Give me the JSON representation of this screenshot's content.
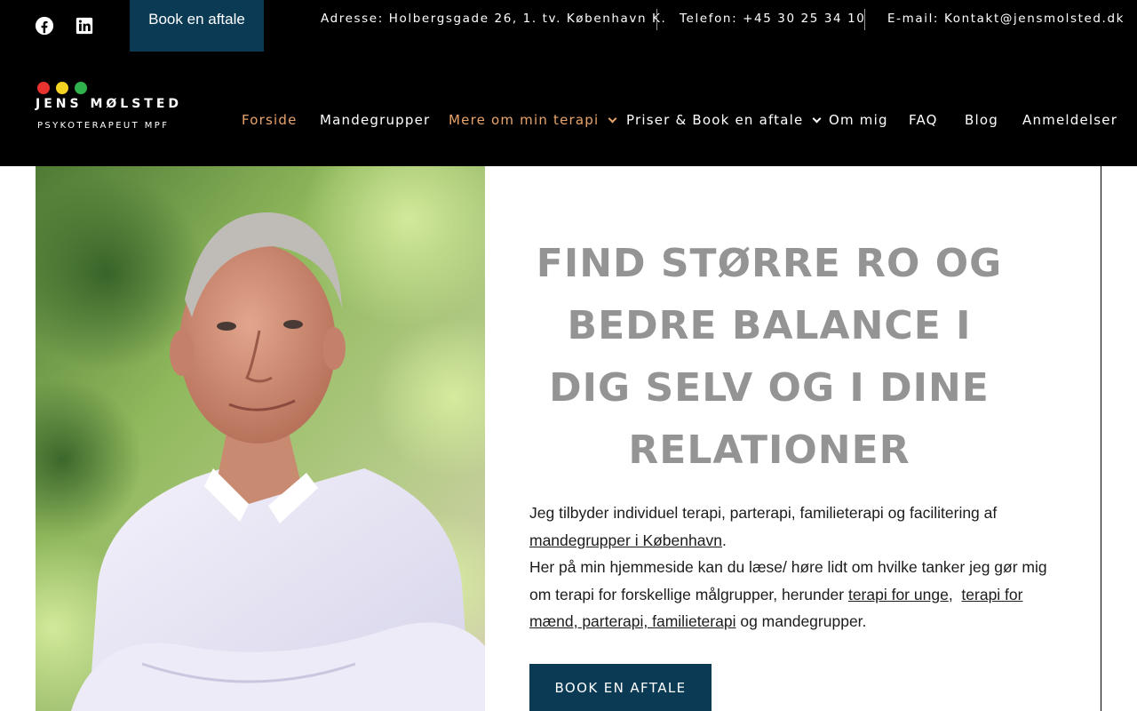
{
  "topbar": {
    "book_label": "Book en aftale",
    "address": "Adresse: Holbergsgade 26, 1. tv. København K.",
    "phone": "Telefon: +45 30 25 34 10",
    "email": "E-mail: Kontakt@jensmolsted.dk",
    "social_icons": [
      "facebook-icon",
      "linkedin-icon"
    ]
  },
  "logo": {
    "name": "JENS MØLSTED",
    "subtitle": "PSYKOTERAPEUT MPF",
    "dot_colors": [
      "#e8332f",
      "#f5d323",
      "#2fb24c"
    ]
  },
  "nav": {
    "items": [
      {
        "label": "Forside",
        "active": true
      },
      {
        "label": "Mandegrupper"
      },
      {
        "label": "Mere om min terapi",
        "dropdown": true
      },
      {
        "label": "Priser & Book en aftale",
        "dropdown": true
      },
      {
        "label": "Om mig"
      },
      {
        "label": "FAQ"
      },
      {
        "label": "Blog"
      },
      {
        "label": "Anmeldelser"
      }
    ]
  },
  "hero": {
    "headline_lines": [
      "FIND STØRRE RO OG",
      "BEDRE BALANCE I",
      "DIG SELV OG I DINE",
      "RELATIONER"
    ],
    "p1_text": "Jeg tilbyder individuel terapi, parterapi, familieterapi og facilitering af",
    "p1_link": "mandegrupper i København",
    "p1_end": ".",
    "p2_text": "Her på min hjemmeside kan du læse/ høre lidt om hvilke tanker jeg gør mig om terapi for forskellige målgrupper, herunder",
    "p2_link1": "terapi for unge",
    "p2_sep": ",",
    "p2_link2": "terapi for mænd, parterapi, familieterapi",
    "p2_end": "og mandegrupper.",
    "cta_label": "BOOK EN AFTALE"
  },
  "colors": {
    "brand_blue": "#0b3a55",
    "nav_active": "#e9a46b",
    "headline": "#949494"
  }
}
